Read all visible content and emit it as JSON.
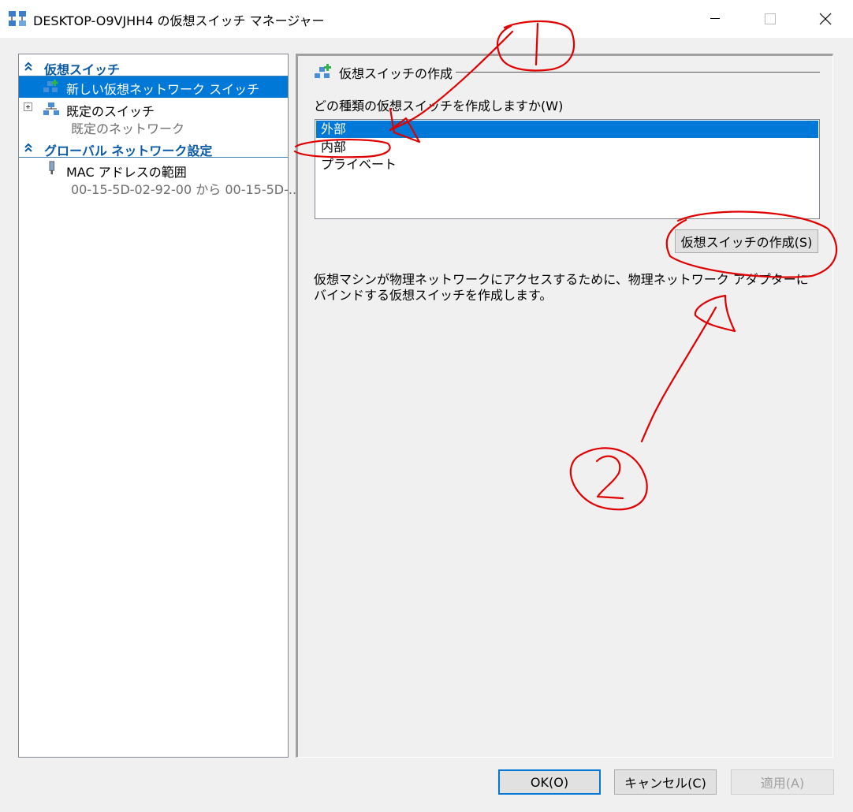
{
  "window": {
    "title": "DESKTOP-O9VJHH4 の仮想スイッチ マネージャー"
  },
  "left": {
    "section1": "仮想スイッチ",
    "new_switch": "新しい仮想ネットワーク スイッチ",
    "default_switch": "既定のスイッチ",
    "default_switch_sub": "既定のネットワーク",
    "section2": "グローバル ネットワーク設定",
    "mac_range": "MAC アドレスの範囲",
    "mac_range_sub": "00-15-5D-02-92-00 から 00-15-5D-..."
  },
  "right": {
    "title": "仮想スイッチの作成",
    "question": "どの種類の仮想スイッチを作成しますか(W)",
    "types": [
      "外部",
      "内部",
      "プライベート"
    ],
    "selected_index": 0,
    "create_button": "仮想スイッチの作成(S)",
    "description": "仮想マシンが物理ネットワークにアクセスするために、物理ネットワーク アダプターにバインドする仮想スイッチを作成します。"
  },
  "buttons": {
    "ok": "OK(O)",
    "cancel": "キャンセル(C)",
    "apply": "適用(A)"
  },
  "colors": {
    "selection": "#0078d7",
    "section_header": "#0b5aa6",
    "annotation": "#e00000"
  }
}
